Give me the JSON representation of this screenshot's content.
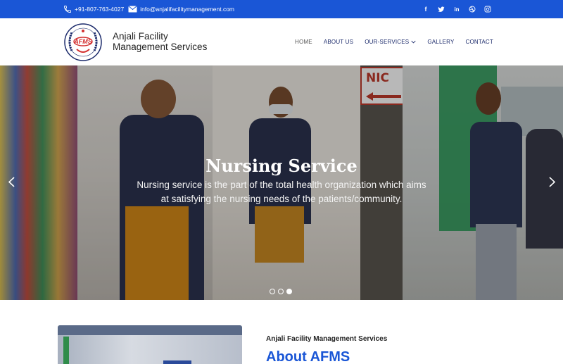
{
  "topbar": {
    "phone": "+91-807-763-4027",
    "email": "info@anjalifacilitymanagement.com",
    "social_icons": [
      "facebook-icon",
      "twitter-icon",
      "linkedin-icon",
      "dribbble-icon",
      "instagram-icon"
    ]
  },
  "header": {
    "logo_text": "AFMS",
    "brand_line1": "Anjali Facility",
    "brand_line2": "Management Services"
  },
  "nav": {
    "items": [
      "HOME",
      "ABOUT US",
      "OUR-SERVICES",
      "GALLERY",
      "CONTACT"
    ]
  },
  "hero": {
    "title": "Nursing Service",
    "text": "Nursing service is the part of the total health organization which aims at satisfying the nursing needs of the patients/community.",
    "sign_text": "NIC",
    "active_slide": 3,
    "slide_count": 3
  },
  "about": {
    "subtitle": "Anjali Facility Management Services",
    "title": "About AFMS"
  },
  "colors": {
    "primary": "#1a56d6",
    "nav_text": "#1b2a6b"
  }
}
